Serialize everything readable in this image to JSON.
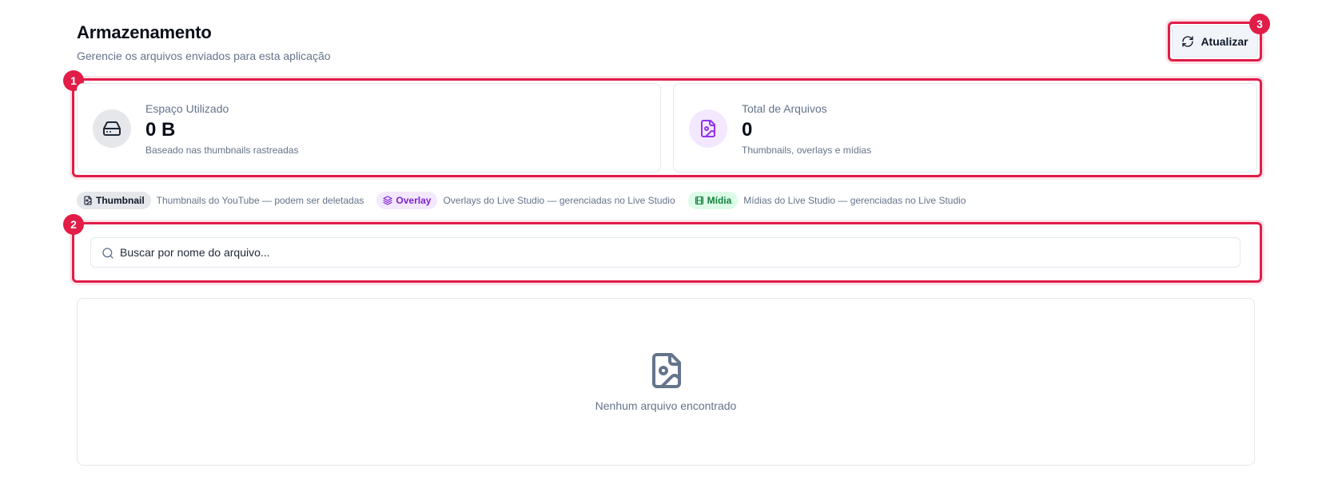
{
  "header": {
    "title": "Armazenamento",
    "subtitle": "Gerencie os arquivos enviados para esta aplicação",
    "refresh_label": "Atualizar"
  },
  "annotations": [
    "1",
    "2",
    "3"
  ],
  "stats": {
    "used_space": {
      "label": "Espaço Utilizado",
      "value": "0 B",
      "description": "Baseado nas thumbnails rastreadas",
      "icon": "hard-drive-icon"
    },
    "total_files": {
      "label": "Total de Arquivos",
      "value": "0",
      "description": "Thumbnails, overlays e mídias",
      "icon": "file-image-icon"
    }
  },
  "legend": [
    {
      "tag": "Thumbnail",
      "text": "Thumbnails do YouTube — podem ser deletadas",
      "icon": "file-image-icon",
      "color": "#0f172a",
      "bg": "#e5e7eb"
    },
    {
      "tag": "Overlay",
      "text": "Overlays do Live Studio — gerenciadas no Live Studio",
      "icon": "layers-icon",
      "color": "#7e22ce",
      "bg": "#f3e8ff"
    },
    {
      "tag": "Mídia",
      "text": "Mídias do Live Studio — gerenciadas no Live Studio",
      "icon": "film-icon",
      "color": "#15803d",
      "bg": "#dcfce7"
    }
  ],
  "search": {
    "placeholder": "Buscar por nome do arquivo...",
    "value": ""
  },
  "empty_state": {
    "message": "Nenhum arquivo encontrado",
    "icon": "file-image-icon"
  },
  "colors": {
    "accent": "#e11d48",
    "purple": "#9333ea",
    "muted": "#64748b"
  }
}
